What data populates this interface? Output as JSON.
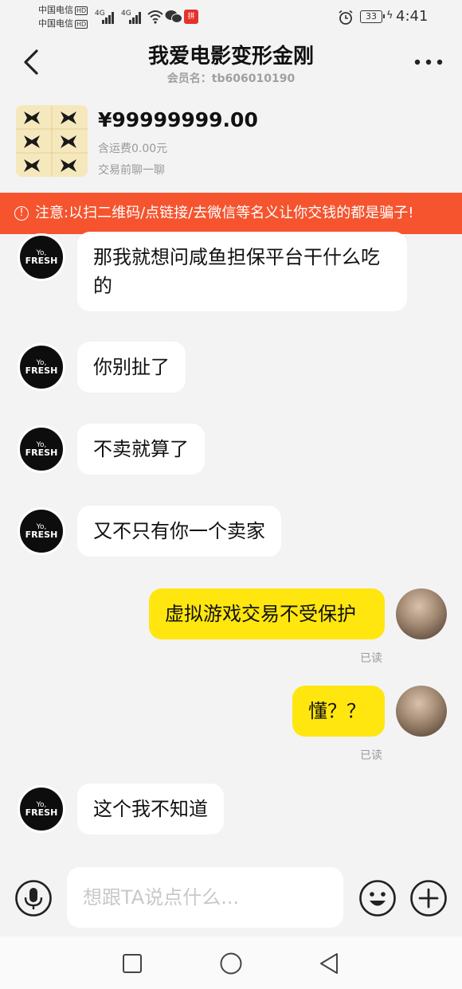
{
  "status_bar": {
    "carrier1": "中国电信",
    "carrier2": "中国电信",
    "hd": "HD",
    "signal1": "4G",
    "signal2": "4G",
    "app_badge": "拼多多",
    "battery": "33",
    "time": "4:41"
  },
  "header": {
    "title": "我爱电影变形金刚",
    "member_label": "会员名：tb606010190"
  },
  "product": {
    "price": "¥99999999.00",
    "shipping": "含运费0.00元",
    "chat_before": "交易前聊一聊"
  },
  "warning": {
    "icon": "!",
    "text": "注意:以扫二维码/点链接/去微信等名义让你交钱的都是骗子!"
  },
  "messages": [
    {
      "side": "left",
      "text": "那我就想问咸鱼担保平台干什么吃的"
    },
    {
      "side": "left",
      "text": "你别扯了"
    },
    {
      "side": "left",
      "text": "不卖就算了"
    },
    {
      "side": "left",
      "text": "又不只有你一个卖家"
    },
    {
      "side": "right",
      "text": "虚拟游戏交易不受保护",
      "status": "已读"
    },
    {
      "side": "right",
      "text": "懂？？",
      "status": "已读"
    },
    {
      "side": "left",
      "text": "这个我不知道"
    }
  ],
  "input": {
    "placeholder": "想跟TA说点什么..."
  },
  "colors": {
    "accent_yellow": "#ffe60f",
    "warning_orange": "#f5542e",
    "background": "#f3f3f3"
  },
  "icons": {
    "back": "chevron-left-icon",
    "more": "more-dots-icon",
    "mic": "microphone-icon",
    "emoji": "emoji-icon",
    "plus": "plus-icon",
    "nav_recent": "square-icon",
    "nav_home": "circle-icon",
    "nav_back": "triangle-back-icon"
  }
}
